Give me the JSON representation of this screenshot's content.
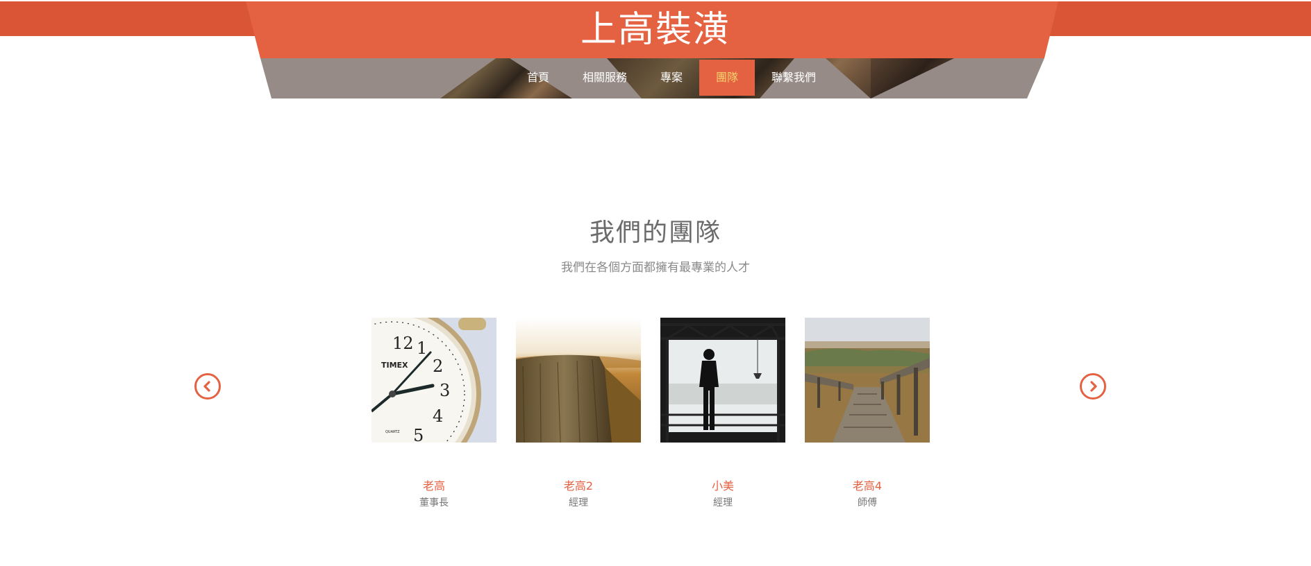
{
  "header": {
    "brand": "上高裝潢",
    "nav": [
      "首頁",
      "相關服務",
      "專案",
      "團隊",
      "聯繫我們"
    ],
    "active_nav": "團隊"
  },
  "team": {
    "title": "我們的團隊",
    "subtitle": "我們在各個方面都擁有最專業的人才",
    "members": [
      {
        "name": "老高",
        "role": "董事長",
        "photo": "pocket-watch-photo"
      },
      {
        "name": "老高2",
        "role": "經理",
        "photo": "tree-stump-photo"
      },
      {
        "name": "小美",
        "role": "經理",
        "photo": "man-at-window-photo"
      },
      {
        "name": "老高4",
        "role": "師傅",
        "photo": "boardwalk-photo"
      }
    ],
    "prev_icon": "chevron-left-icon",
    "next_icon": "chevron-right-icon"
  },
  "colors": {
    "accent": "#e46142",
    "top_band": "#d95535",
    "nav_panel": "#968b86",
    "active_nav_text": "#f3d26d",
    "title_text": "#6b6b6b"
  }
}
